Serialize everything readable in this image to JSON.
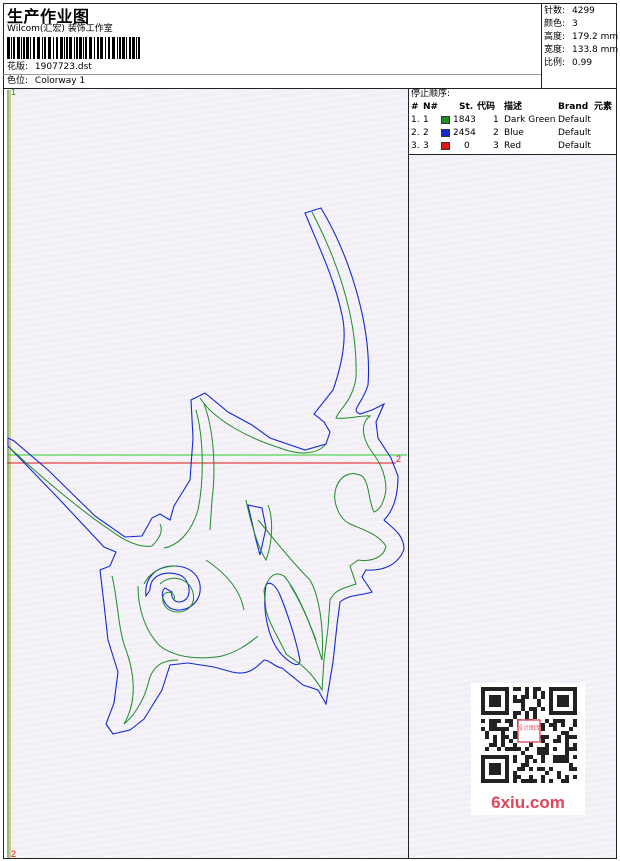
{
  "header": {
    "title": "生产作业图",
    "subtitle": "Wilcom(汇宏) 装饰工作室",
    "design_label": "花版:",
    "design_value": "1907723.dst",
    "colorway_label": "色位:",
    "colorway_value": "Colorway 1"
  },
  "stats": [
    {
      "label": "针数:",
      "value": "4299"
    },
    {
      "label": "颜色:",
      "value": "3"
    },
    {
      "label": "高度:",
      "value": "179.2 mm"
    },
    {
      "label": "宽度:",
      "value": "133.8 mm"
    },
    {
      "label": "比例:",
      "value": "0.99"
    }
  ],
  "stop_sequence": {
    "label": "停止顺序:",
    "headers": {
      "hash": "#",
      "n": "N#",
      "st": "St.",
      "code": "代码",
      "desc": "描述",
      "brand": "Brand",
      "element": "元素"
    },
    "rows": [
      {
        "idx": "1.",
        "n": "1",
        "color": "#1f8a2a",
        "st": "1843",
        "code": "1",
        "desc": "Dark Green",
        "brand": "Default"
      },
      {
        "idx": "2.",
        "n": "2",
        "color": "#1428d2",
        "st": "2454",
        "code": "2",
        "desc": "Blue",
        "brand": "Default"
      },
      {
        "idx": "3.",
        "n": "3",
        "color": "#e01818",
        "st": "0",
        "code": "3",
        "desc": "Red",
        "brand": "Default"
      }
    ]
  },
  "markers": {
    "top_left": "1",
    "bottom_left": "2",
    "red_line_end": "2"
  },
  "watermark": {
    "text": "6xiu.com",
    "qr_badge": "设计图库"
  },
  "colors": {
    "green": "#1f8a2a",
    "blue": "#1428d2",
    "red": "#e01818",
    "bg": "#f2f0f6"
  }
}
